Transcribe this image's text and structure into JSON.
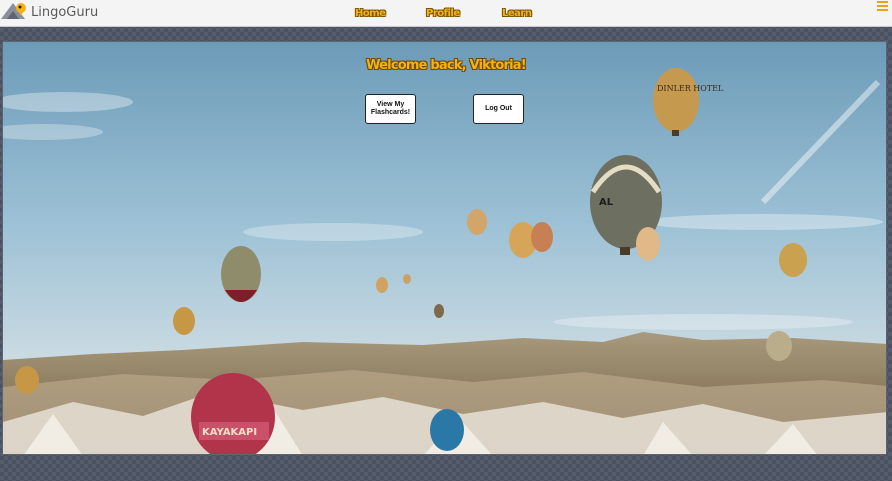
{
  "app": {
    "name": "LingoGuru"
  },
  "nav": {
    "links": [
      "Home",
      "Profile",
      "Learn"
    ]
  },
  "hero": {
    "welcome": "Welcome back, Viktoria!",
    "flashcards_button": "View My Flashcards!",
    "logout_button": "Log Out",
    "balloon_labels": [
      "DINLER HOTEL",
      "AL",
      "KAYAKAPI"
    ]
  },
  "icons": [
    "lingoguru-logo-icon",
    "hamburger-menu-icon"
  ],
  "colors": {
    "accent": "#f2b316",
    "navbar": "#f4f4f4",
    "page_bg": "#4a5262"
  }
}
